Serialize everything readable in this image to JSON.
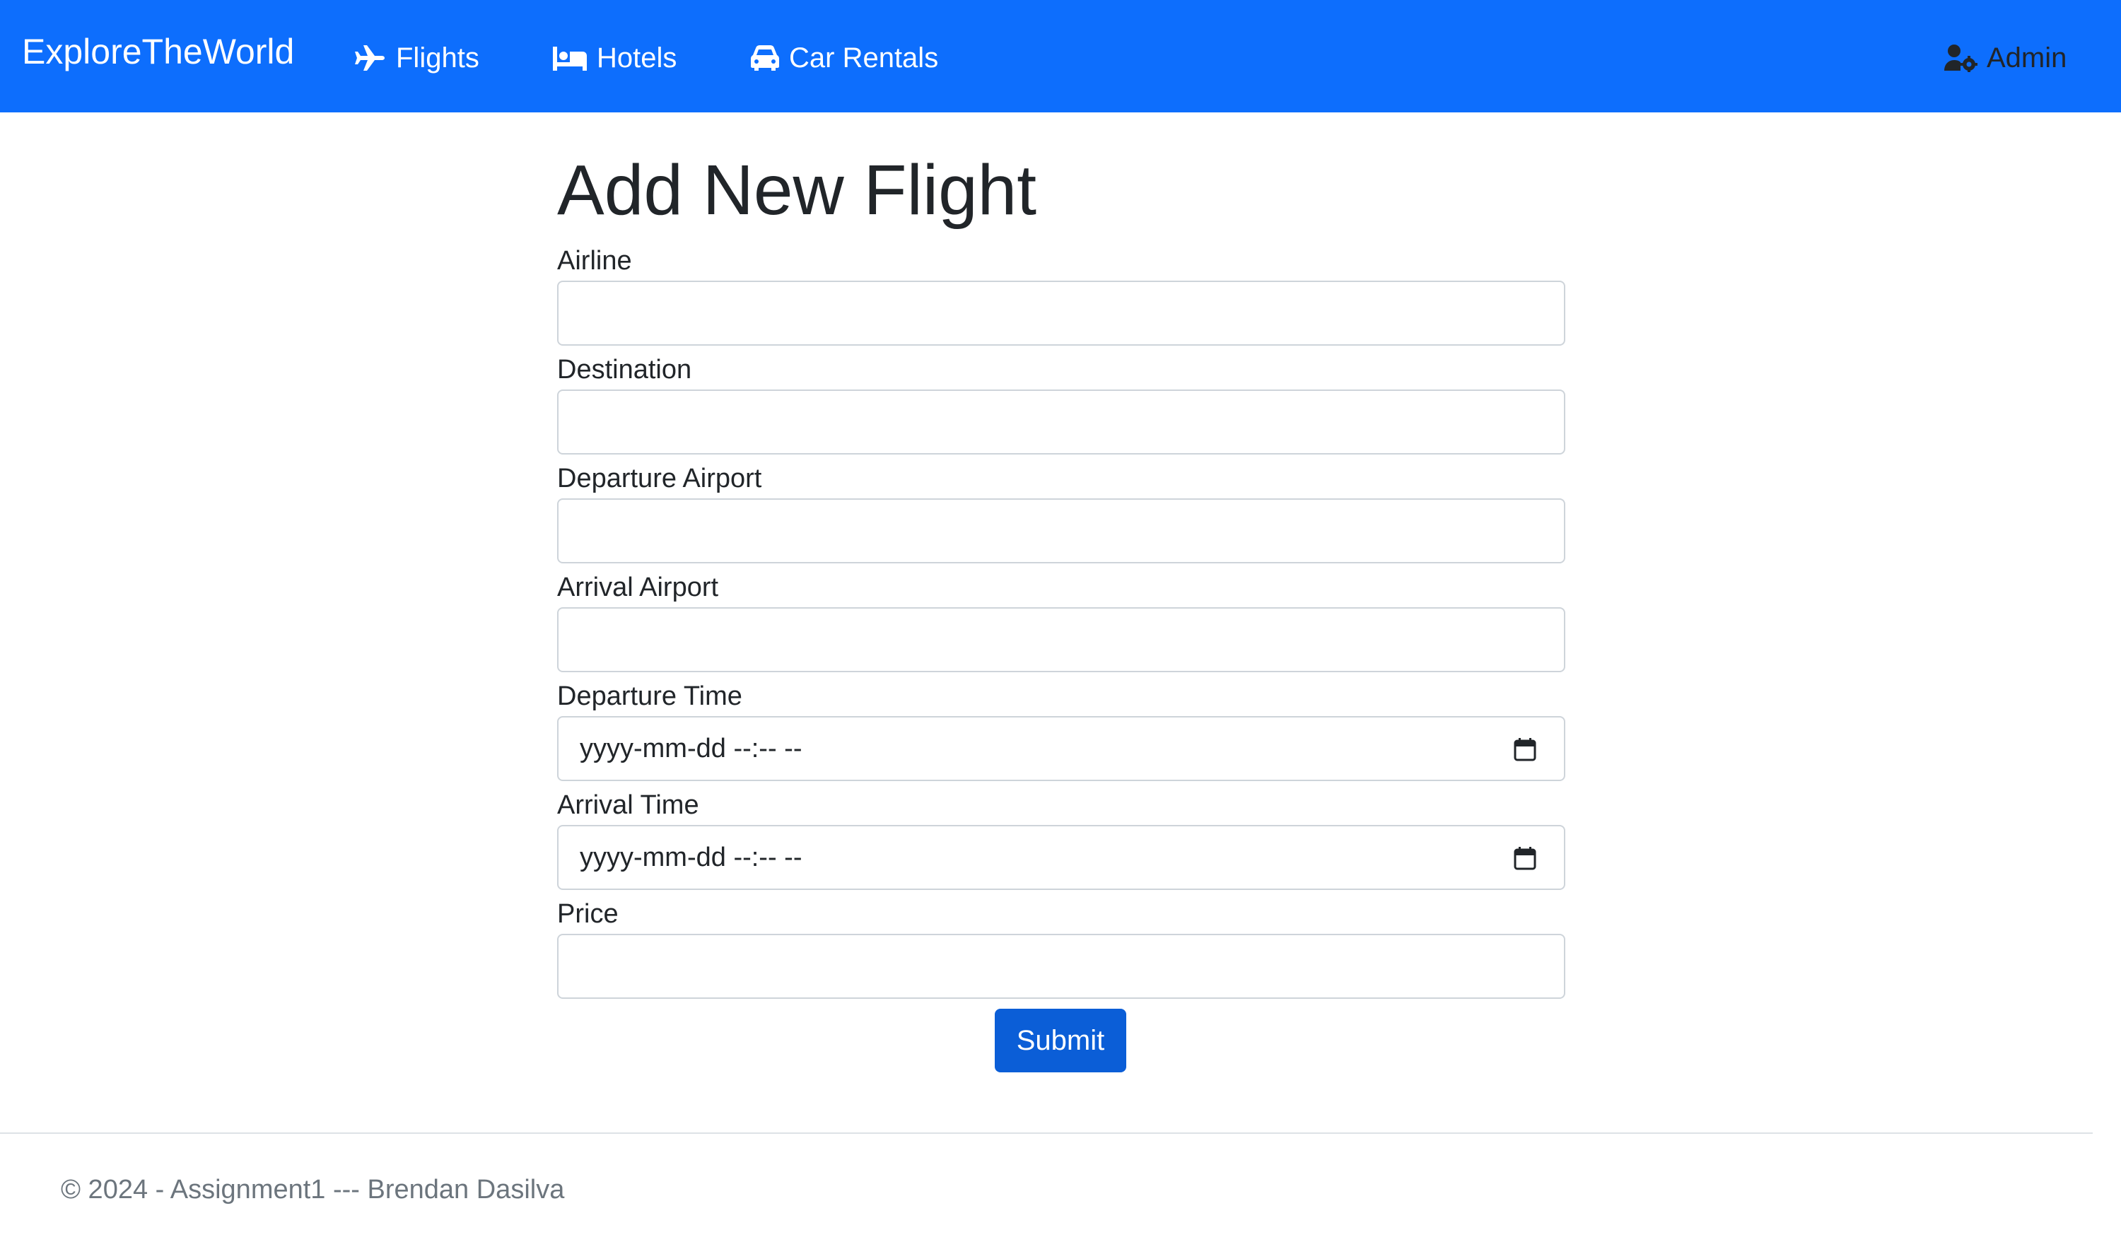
{
  "navbar": {
    "brand": "ExploreTheWorld",
    "items": [
      {
        "label": "Flights",
        "icon": "plane-icon"
      },
      {
        "label": "Hotels",
        "icon": "bed-icon"
      },
      {
        "label": "Car Rentals",
        "icon": "car-icon"
      }
    ],
    "admin": {
      "label": "Admin",
      "icon": "user-gear-icon"
    },
    "background_color": "#0d6efd"
  },
  "form": {
    "title": "Add New Flight",
    "fields": [
      {
        "label": "Airline",
        "value": ""
      },
      {
        "label": "Destination",
        "value": ""
      },
      {
        "label": "Departure Airport",
        "value": ""
      },
      {
        "label": "Arrival Airport",
        "value": ""
      },
      {
        "label": "Departure Time",
        "value": "yyyy-mm-dd --:-- --",
        "icon": "calendar-icon"
      },
      {
        "label": "Arrival Time",
        "value": "yyyy-mm-dd --:-- --",
        "icon": "calendar-icon"
      },
      {
        "label": "Price",
        "value": ""
      }
    ],
    "submit_label": "Submit",
    "submit_color": "#0b5ed7"
  },
  "footer": {
    "text": "© 2024 - Assignment1 --- Brendan Dasilva"
  }
}
